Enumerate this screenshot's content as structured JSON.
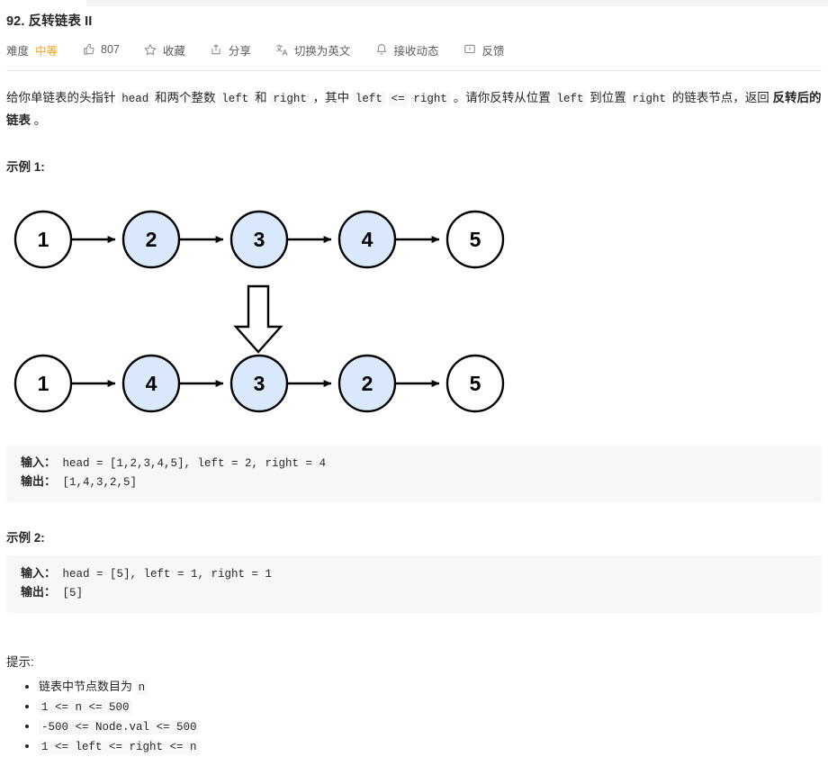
{
  "header": {
    "title": "92. 反转链表 II",
    "meta": {
      "difficulty_label": "难度",
      "difficulty_value": "中等",
      "difficulty_color": "#ffa116",
      "like_icon": "thumbs-up-icon",
      "like_count": "807",
      "favorite_icon": "star-icon",
      "favorite_label": "收藏",
      "share_icon": "share-icon",
      "share_label": "分享",
      "translate_icon": "translate-icon",
      "translate_label": "切换为英文",
      "notify_icon": "bell-icon",
      "notify_label": "接收动态",
      "feedback_icon": "feedback-icon",
      "feedback_label": "反馈"
    }
  },
  "description": {
    "part1": "给你单链表的头指针 ",
    "code_head": "head",
    "part2": " 和两个整数 ",
    "code_left1": "left",
    "part3": " 和 ",
    "code_right1": "right",
    "part4": " ，其中 ",
    "code_left2": "left",
    "part5": " ",
    "code_lte": "<=",
    "part6": " ",
    "code_right2": "right",
    "part7": " 。请你反转从位置 ",
    "code_left3": "left",
    "part8": " 到位置 ",
    "code_right3": "right",
    "part9": " 的链表节点，返回 ",
    "bold_tail": "反转后的链表",
    "part10": " 。"
  },
  "example1": {
    "title": "示例 1:",
    "input_label": "输入：",
    "input_value": " head = [1,2,3,4,5], left = 2, right = 4",
    "output_label": "输出：",
    "output_value": " [1,4,3,2,5]"
  },
  "example2": {
    "title": "示例 2:",
    "input_label": "输入：",
    "input_value": " head = [5], left = 1, right = 1",
    "output_label": "输出：",
    "output_value": " [5]"
  },
  "diagram": {
    "highlight_fill": "#d9e8fb",
    "plain_fill": "#ffffff",
    "stroke": "#000000",
    "before": [
      {
        "value": "1",
        "highlight": false
      },
      {
        "value": "2",
        "highlight": true
      },
      {
        "value": "3",
        "highlight": true
      },
      {
        "value": "4",
        "highlight": true
      },
      {
        "value": "5",
        "highlight": false
      }
    ],
    "after": [
      {
        "value": "1",
        "highlight": false
      },
      {
        "value": "4",
        "highlight": true
      },
      {
        "value": "3",
        "highlight": true
      },
      {
        "value": "2",
        "highlight": true
      },
      {
        "value": "5",
        "highlight": false
      }
    ],
    "transform_arrow": "down-arrow-outline"
  },
  "hints": {
    "title": "提示:",
    "items": [
      {
        "text": "链表中节点数目为 ",
        "code": "n",
        "code_only": false
      },
      {
        "text": "",
        "code": "1 <= n <= 500",
        "code_only": true
      },
      {
        "text": "",
        "code": "-500 <= Node.val <= 500",
        "code_only": true
      },
      {
        "text": "",
        "code": "1 <= left <= right <= n",
        "code_only": true
      }
    ]
  }
}
